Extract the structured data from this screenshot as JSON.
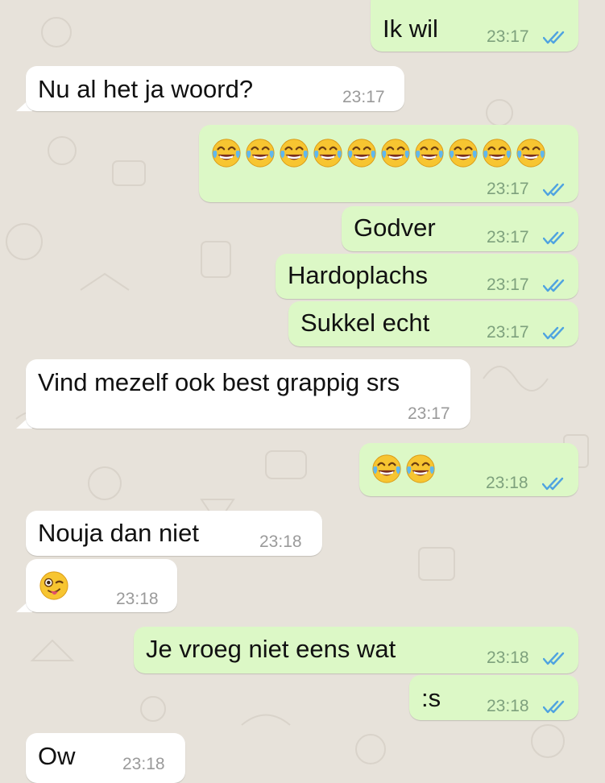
{
  "chat": {
    "messages": [
      {
        "direction": "outgoing",
        "text": "Ik wil",
        "time": "23:17",
        "status": "read-double-check-icon"
      },
      {
        "direction": "incoming",
        "text": "Nu al het ja woord?",
        "time": "23:17"
      },
      {
        "direction": "outgoing",
        "emoji": "face-with-tears-of-joy",
        "emoji_count": 10,
        "time": "23:17",
        "status": "read-double-check-icon"
      },
      {
        "direction": "outgoing",
        "text": "Godver",
        "time": "23:17",
        "status": "read-double-check-icon"
      },
      {
        "direction": "outgoing",
        "text": "Hardoplachs",
        "time": "23:17",
        "status": "read-double-check-icon"
      },
      {
        "direction": "outgoing",
        "text": "Sukkel echt",
        "time": "23:17",
        "status": "read-double-check-icon"
      },
      {
        "direction": "incoming",
        "text": "Vind mezelf ook best grappig srs",
        "time": "23:17"
      },
      {
        "direction": "outgoing",
        "emoji": "face-with-tears-of-joy",
        "emoji_count": 2,
        "time": "23:18",
        "status": "read-double-check-icon"
      },
      {
        "direction": "incoming",
        "text": "Nouja dan niet",
        "time": "23:18"
      },
      {
        "direction": "incoming",
        "emoji": "winking-face-with-tongue",
        "emoji_count": 1,
        "time": "23:18"
      },
      {
        "direction": "outgoing",
        "text": "Je vroeg niet eens wat",
        "time": "23:18",
        "status": "read-double-check-icon"
      },
      {
        "direction": "outgoing",
        "text": ":s",
        "time": "23:18",
        "status": "read-double-check-icon"
      },
      {
        "direction": "incoming",
        "text": "Ow",
        "time": "23:18"
      }
    ]
  },
  "colors": {
    "wallpaper": "#e7e2da",
    "incoming_bubble": "#ffffff",
    "outgoing_bubble": "#dcf8c6",
    "read_ticks": "#4fa3e0"
  }
}
